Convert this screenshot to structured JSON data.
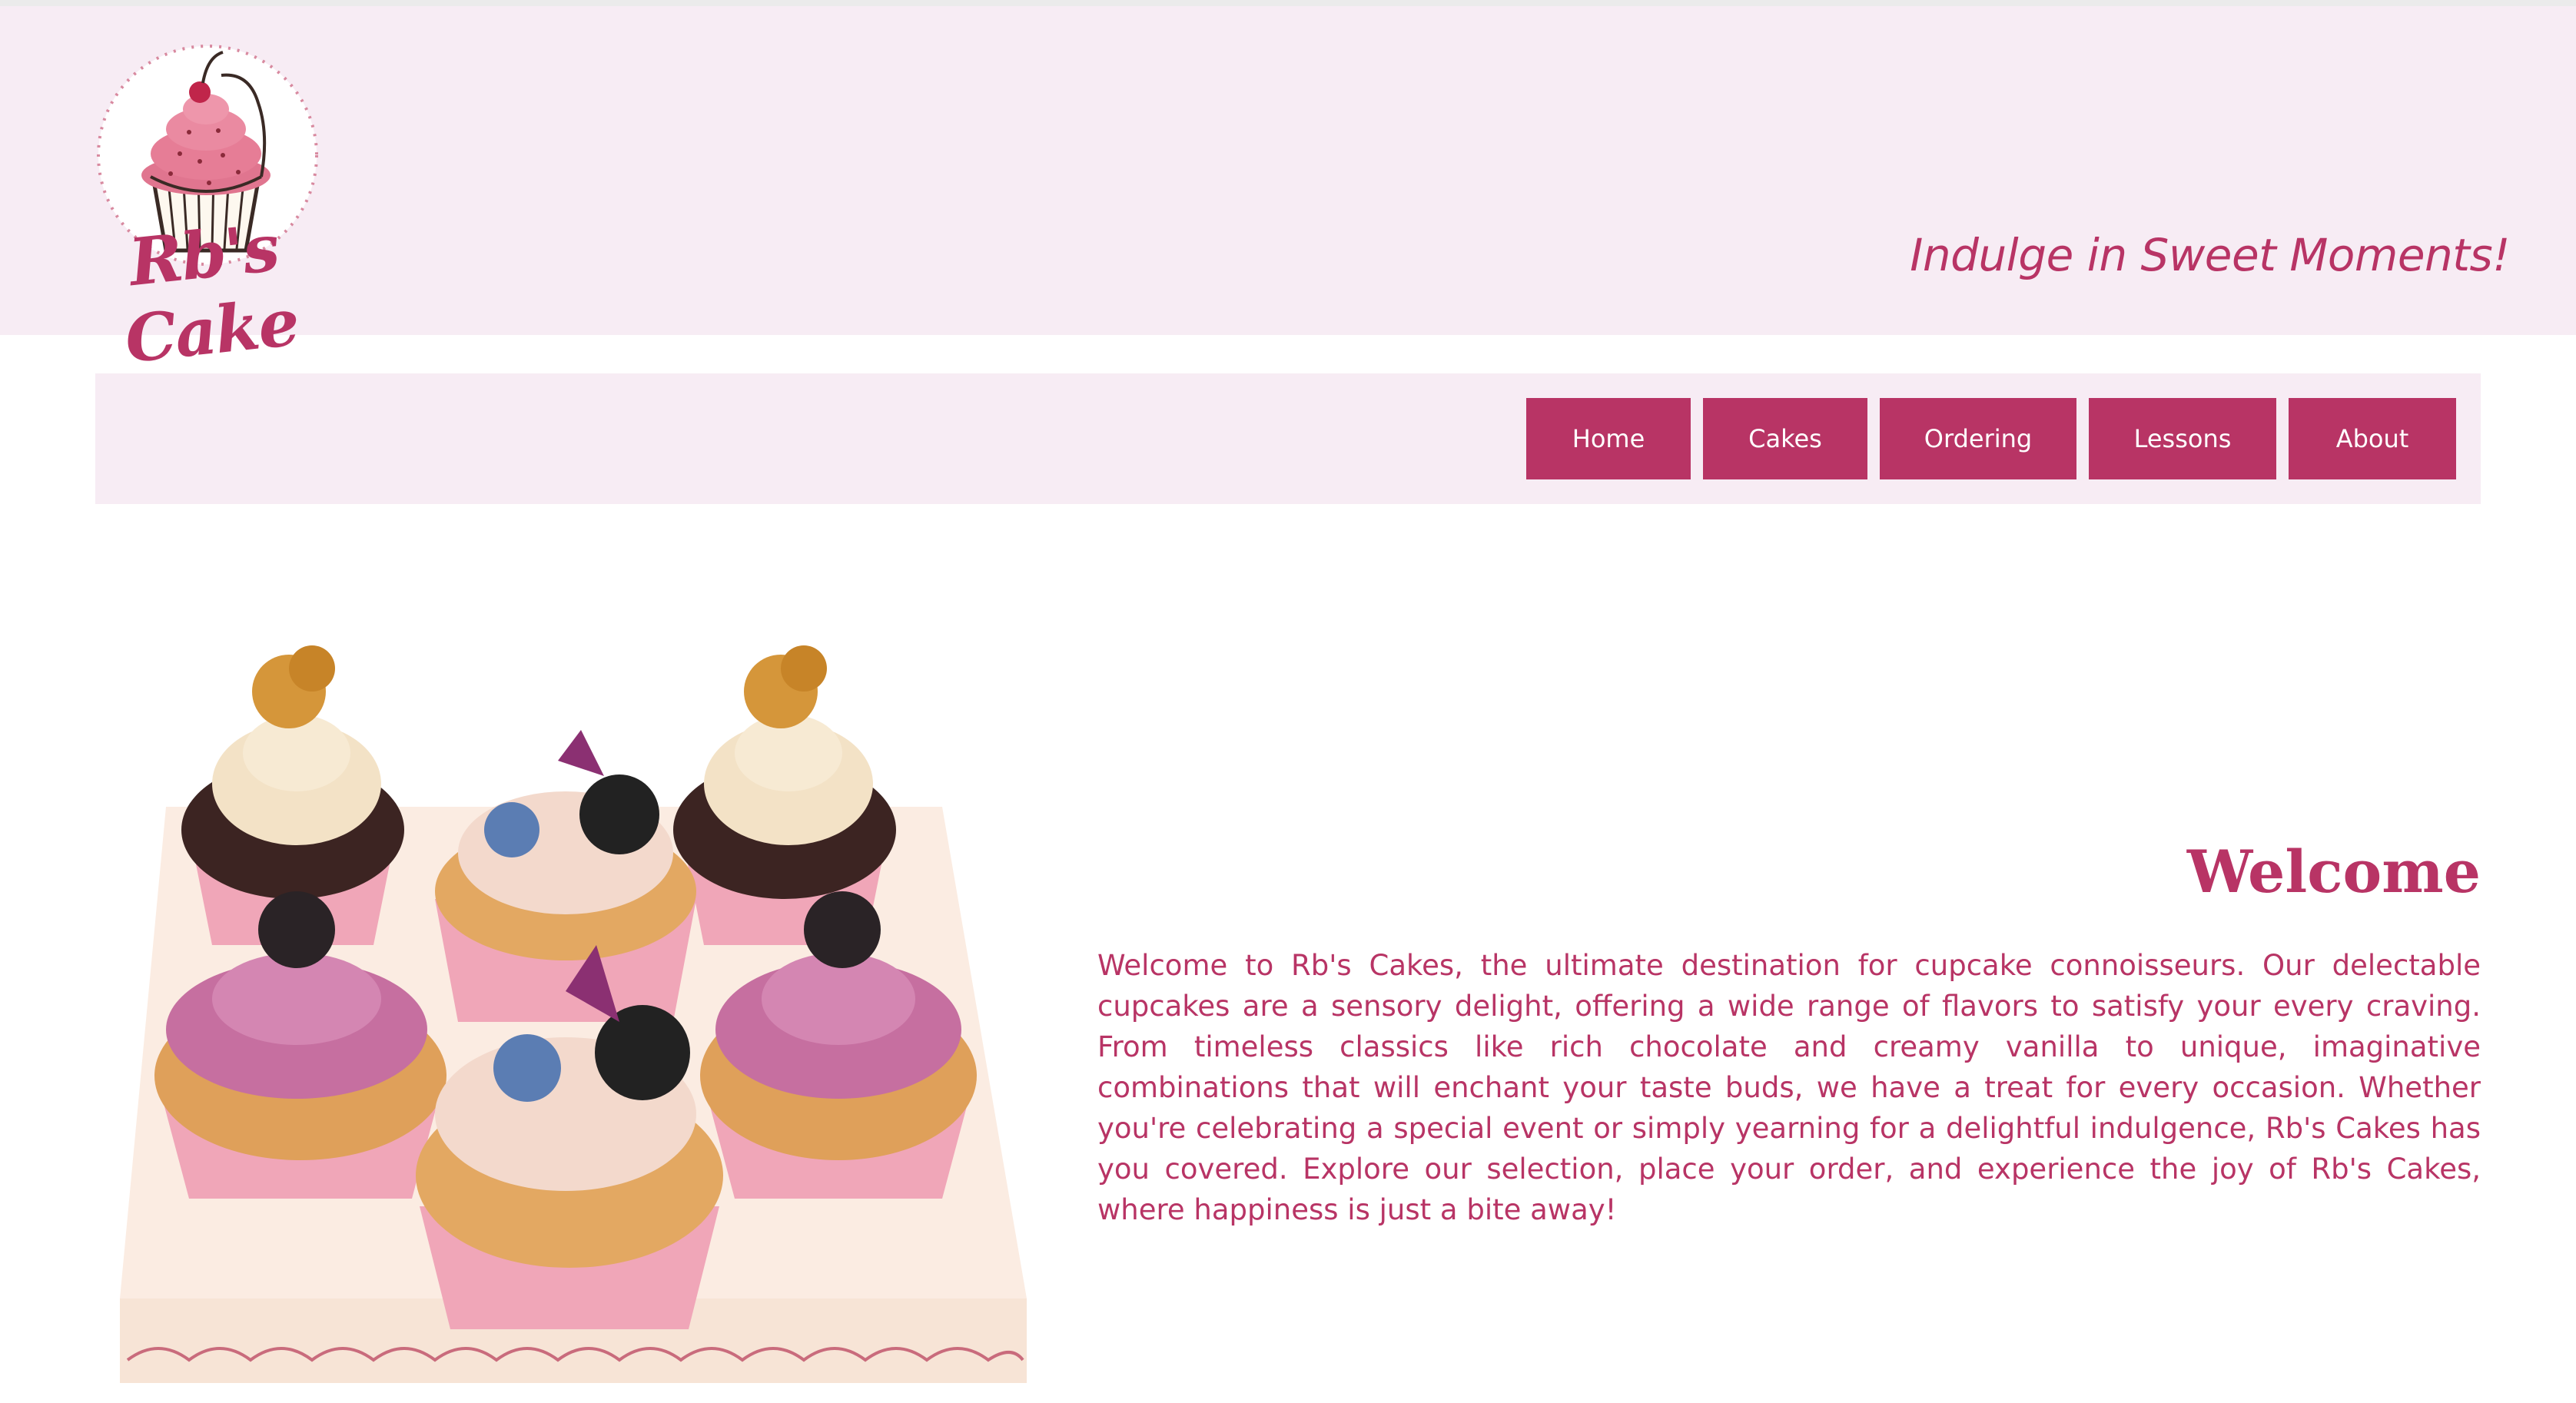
{
  "brand": {
    "logo_text": "Rb's Cake",
    "tagline": "Indulge in Sweet Moments!",
    "accent_color": "#b83465",
    "header_bg": "#f7ecf4"
  },
  "nav": {
    "items": [
      {
        "label": "Home"
      },
      {
        "label": "Cakes"
      },
      {
        "label": "Ordering"
      },
      {
        "label": "Lessons"
      },
      {
        "label": "About"
      }
    ]
  },
  "main": {
    "heading": "Welcome",
    "body": "Welcome to Rb's Cakes, the ultimate destination for cupcake connoisseurs. Our delectable cupcakes are a sensory delight, offering a wide range of flavors to satisfy your every craving. From timeless classics like rich chocolate and creamy vanilla to unique, imaginative combinations that will enchant your taste buds, we have a treat for every occasion. Whether you're celebrating a special event or simply yearning for a delightful indulgence, Rb's Cakes has you covered. Explore our selection, place your order, and experience the joy of Rb's Cakes, where happiness is just a bite away!",
    "hero_image": "cupcakes-photo"
  }
}
